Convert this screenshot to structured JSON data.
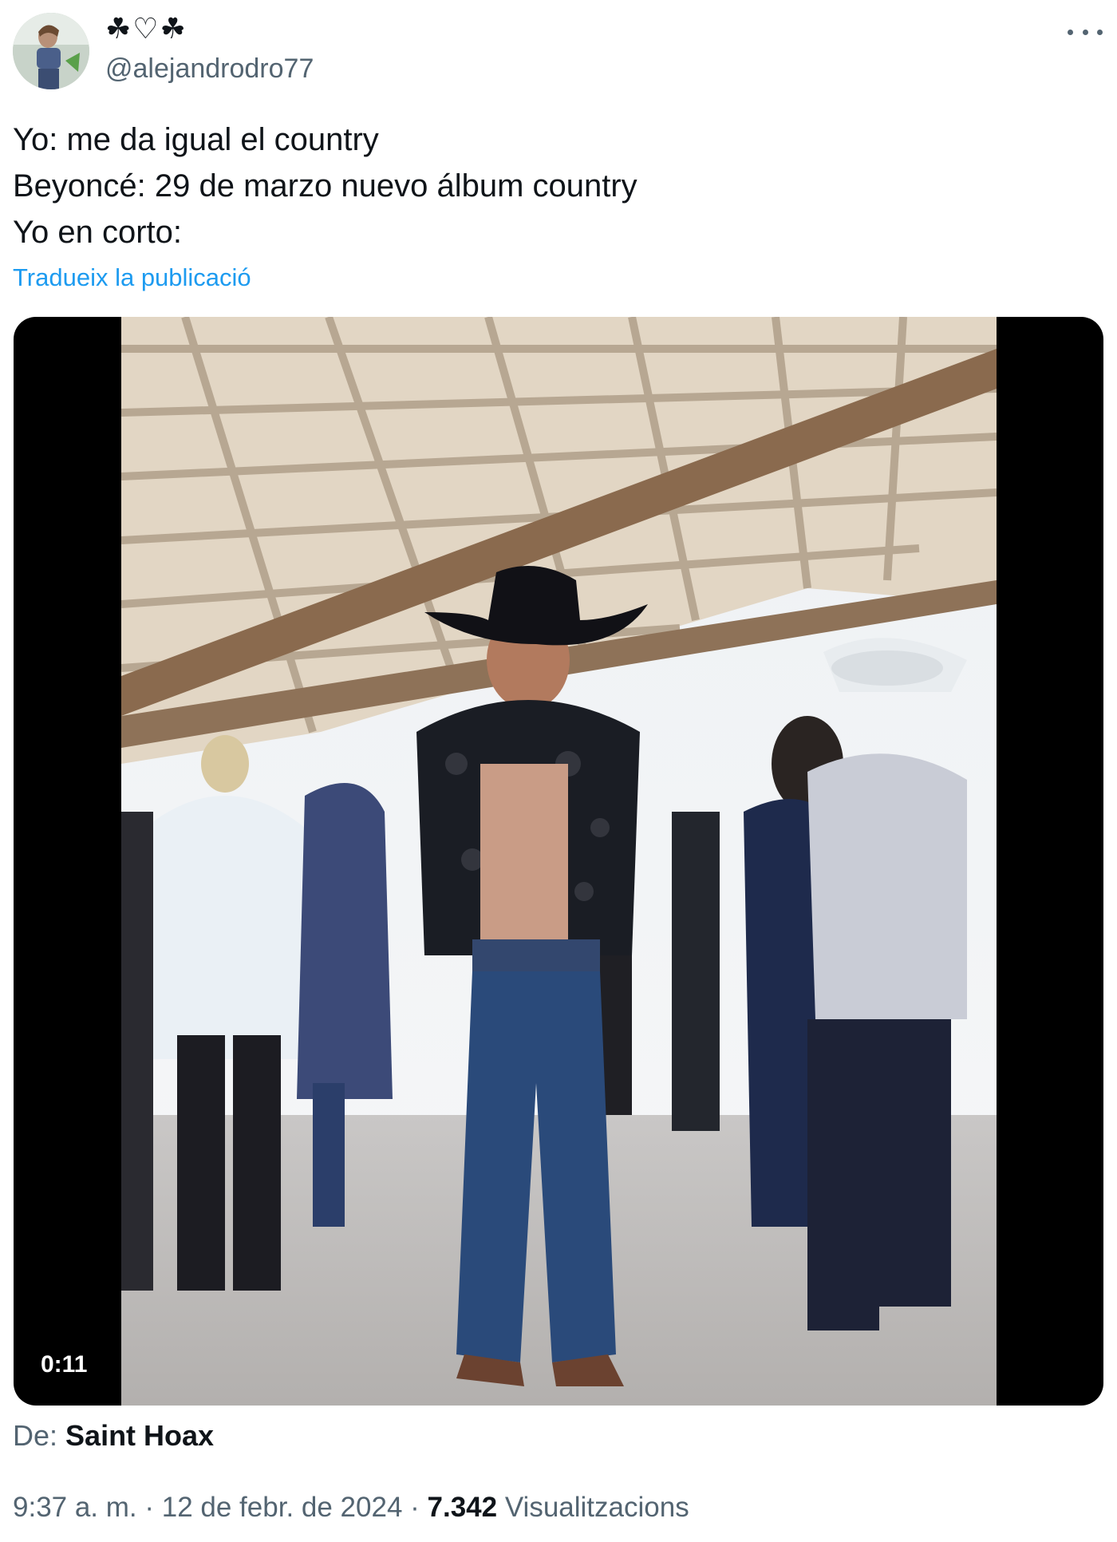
{
  "author": {
    "display_name": "☘♡☘",
    "handle": "@alejandrodro77",
    "avatar_icon": "user-avatar"
  },
  "more_icon": "more-horizontal-icon",
  "tweet": {
    "lines": [
      "Yo: me da igual el country",
      "Beyoncé: 29 de marzo nuevo álbum country",
      "Yo en corto:"
    ],
    "translate_label": "Tradueix la publicació"
  },
  "media": {
    "type": "video",
    "duration": "0:11",
    "description_icon": "video-thumbnail"
  },
  "attribution": {
    "prefix": "De: ",
    "source": "Saint Hoax"
  },
  "meta": {
    "time": "9:37 a. m.",
    "separator": " · ",
    "date": "12 de febr. de 2024",
    "views_count": "7.342",
    "views_label": " Visualitzacions"
  },
  "colors": {
    "link": "#1d9bf0",
    "secondary_text": "#536471",
    "primary_text": "#0f1419"
  }
}
